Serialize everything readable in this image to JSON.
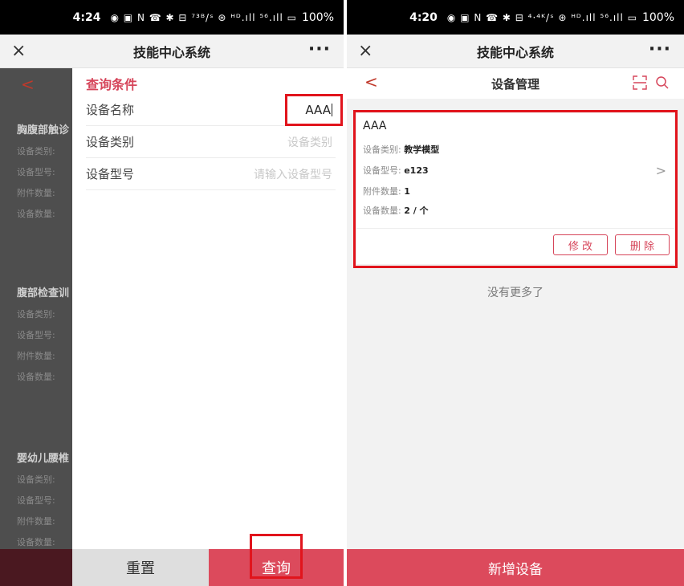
{
  "left": {
    "status": {
      "time": "4:24",
      "icons": "◉ ▣  N ☎ ✱ ⊟ ⁷³ᴮ/ˢ ⊛ ᴴᴰ.ıll ⁵⁶.ıll ▭",
      "battery": "100%"
    },
    "appbar": {
      "close": "×",
      "title": "技能中心系统",
      "more": "···"
    },
    "background_list": {
      "back": "<",
      "items": [
        {
          "name": "胸腹部触诊",
          "fields": [
            "设备类别:",
            "设备型号:",
            "附件数量:",
            "设备数量:"
          ]
        },
        {
          "name": "腹部检查训",
          "fields": [
            "设备类别:",
            "设备型号:",
            "附件数量:",
            "设备数量:"
          ]
        },
        {
          "name": "婴幼儿腰椎",
          "fields": [
            "设备类别:",
            "设备型号:",
            "附件数量:",
            "设备数量:"
          ]
        }
      ]
    },
    "query_panel": {
      "title": "查询条件",
      "rows": [
        {
          "label": "设备名称",
          "value": "AAA",
          "placeholder": ""
        },
        {
          "label": "设备类别",
          "value": "",
          "placeholder": "设备类别"
        },
        {
          "label": "设备型号",
          "value": "",
          "placeholder": "请输入设备型号"
        }
      ]
    },
    "bottom": {
      "reset": "重置",
      "query": "查询"
    }
  },
  "right": {
    "status": {
      "time": "4:20",
      "icons": "◉ ▣  N ☎ ✱ ⊟ ⁴·⁴ᴷ/ˢ ⊛ ᴴᴰ.ıll ⁵⁶.ıll ▭",
      "battery": "100%"
    },
    "appbar": {
      "close": "×",
      "title": "技能中心系统",
      "more": "···"
    },
    "subbar": {
      "back": "<",
      "title": "设备管理"
    },
    "card": {
      "name": "AAA",
      "category_label": "设备类别:",
      "category": "教学模型",
      "model_label": "设备型号:",
      "model": "e123",
      "accessories_label": "附件数量:",
      "accessories": "1",
      "quantity_label": "设备数量:",
      "quantity": "2 / 个",
      "chevron": ">",
      "edit": "修 改",
      "delete": "删 除"
    },
    "no_more": "没有更多了",
    "add_button": "新增设备"
  },
  "colors": {
    "accent": "#dc4a5c",
    "highlight_box": "#e1141c",
    "title_red": "#d6455a"
  }
}
